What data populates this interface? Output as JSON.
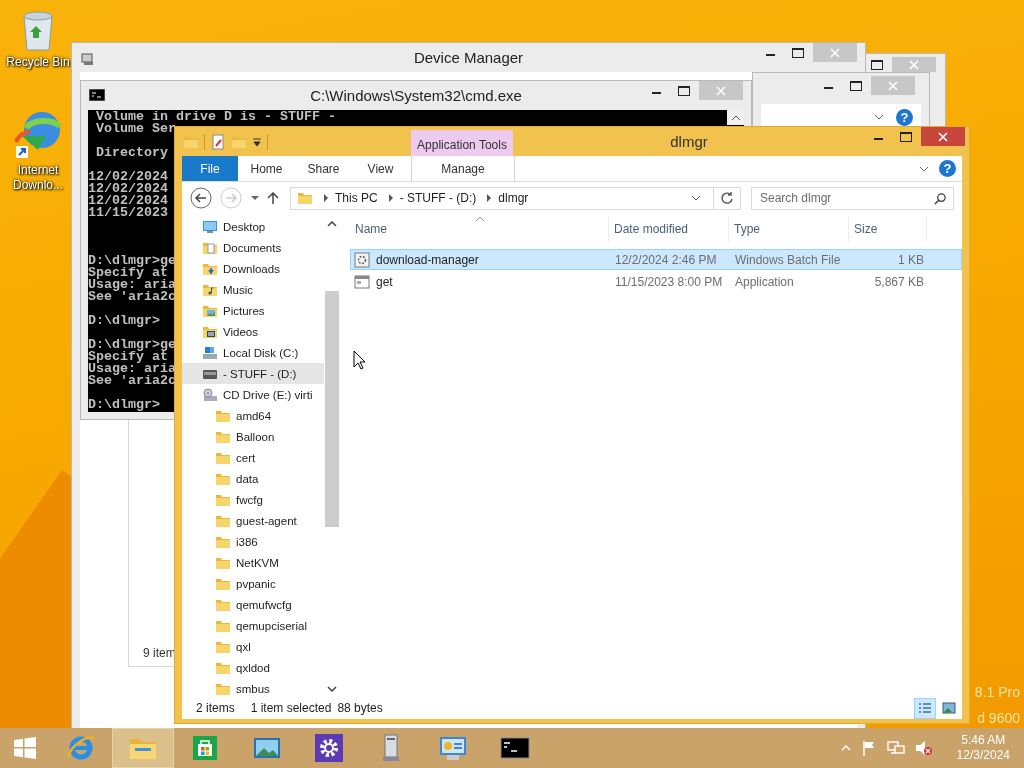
{
  "desktop": {
    "icons": [
      {
        "label": "Recycle Bin",
        "kind": "recycle-bin"
      },
      {
        "label": "Internet Downlo...",
        "kind": "download-app"
      }
    ],
    "edition_lines": [
      "8.1 Pro",
      "d 9600"
    ]
  },
  "device_manager": {
    "title": "Device Manager",
    "status": "9 item"
  },
  "help_window": {
    "help": "?"
  },
  "cmd": {
    "title": "C:\\Windows\\System32\\cmd.exe",
    "blocks": [
      {
        "kind": "output",
        "lines": [
          "Volume in drive D is - STUFF -",
          "Volume Ser"
        ]
      },
      {
        "kind": "output",
        "lines": [
          "Directory"
        ]
      },
      {
        "kind": "listing",
        "lines": [
          "12/02/2024",
          "12/02/2024",
          "12/02/2024",
          "11/15/2023"
        ]
      },
      {
        "kind": "output",
        "lines": [
          "D:\\dlmgr>ge",
          "Specify at",
          "Usage: aria",
          "See 'aria2c"
        ]
      },
      {
        "kind": "output",
        "lines": [
          "D:\\dlmgr>"
        ]
      },
      {
        "kind": "output",
        "lines": [
          "D:\\dlmgr>ge",
          "Specify at",
          "Usage: aria",
          "See 'aria2c"
        ]
      },
      {
        "kind": "output",
        "lines": [
          "D:\\dlmgr>"
        ]
      }
    ]
  },
  "explorer": {
    "title": "dlmgr",
    "context_group": "Application Tools",
    "help": "?",
    "tabs": [
      {
        "label": "File",
        "kind": "file"
      },
      {
        "label": "Home",
        "kind": "tab"
      },
      {
        "label": "Share",
        "kind": "tab"
      },
      {
        "label": "View",
        "kind": "tab"
      },
      {
        "label": "Manage",
        "kind": "context"
      }
    ],
    "address": [
      "This PC",
      "- STUFF - (D:)",
      "dlmgr"
    ],
    "search": {
      "placeholder": "Search dlmgr"
    },
    "tree": [
      {
        "label": "Desktop",
        "kind": "desktop",
        "selected": false
      },
      {
        "label": "Documents",
        "kind": "documents",
        "selected": false
      },
      {
        "label": "Downloads",
        "kind": "downloads",
        "selected": false
      },
      {
        "label": "Music",
        "kind": "music",
        "selected": false
      },
      {
        "label": "Pictures",
        "kind": "pictures",
        "selected": false
      },
      {
        "label": "Videos",
        "kind": "videos",
        "selected": false
      },
      {
        "label": "Local Disk (C:)",
        "kind": "disk",
        "selected": false
      },
      {
        "label": "- STUFF - (D:)",
        "kind": "drive",
        "selected": true
      },
      {
        "label": "CD Drive (E:) virti",
        "kind": "cd",
        "selected": false,
        "children": [
          {
            "label": "amd64",
            "kind": "folder",
            "selected": false
          },
          {
            "label": "Balloon",
            "kind": "folder",
            "selected": false
          },
          {
            "label": "cert",
            "kind": "folder",
            "selected": false
          },
          {
            "label": "data",
            "kind": "folder",
            "selected": false
          },
          {
            "label": "fwcfg",
            "kind": "folder",
            "selected": false
          },
          {
            "label": "guest-agent",
            "kind": "folder",
            "selected": false
          },
          {
            "label": "i386",
            "kind": "folder",
            "selected": false
          },
          {
            "label": "NetKVM",
            "kind": "folder",
            "selected": false
          },
          {
            "label": "pvpanic",
            "kind": "folder",
            "selected": false
          },
          {
            "label": "qemufwcfg",
            "kind": "folder",
            "selected": false
          },
          {
            "label": "qemupciserial",
            "kind": "folder",
            "selected": false
          },
          {
            "label": "qxl",
            "kind": "folder",
            "selected": false
          },
          {
            "label": "qxldod",
            "kind": "folder",
            "selected": false
          },
          {
            "label": "smbus",
            "kind": "folder",
            "selected": false
          }
        ]
      }
    ],
    "files": {
      "columns": [
        "Name",
        "Date modified",
        "Type",
        "Size"
      ],
      "rows": [
        {
          "name": "download-manager",
          "kind": "batch",
          "date": "12/2/2024 2:46 PM",
          "type": "Windows Batch File",
          "size": "1 KB",
          "selected": true
        },
        {
          "name": "get",
          "kind": "application",
          "date": "11/15/2023 8:00 PM",
          "type": "Application",
          "size": "5,867 KB",
          "selected": false
        }
      ]
    },
    "status": [
      "2 items",
      "1 item selected",
      "88 bytes"
    ],
    "views": [
      {
        "kind": "details",
        "selected": true
      },
      {
        "kind": "large-icons",
        "selected": false
      }
    ]
  },
  "taskbar": {
    "apps": [
      {
        "kind": "browser",
        "selected": false
      },
      {
        "kind": "file-explorer",
        "selected": true
      },
      {
        "kind": "store",
        "selected": false
      },
      {
        "kind": "photos",
        "selected": false
      },
      {
        "kind": "settings",
        "selected": false
      },
      {
        "kind": "server",
        "selected": false
      },
      {
        "kind": "control-panel",
        "selected": false
      },
      {
        "kind": "console",
        "selected": false
      }
    ],
    "time": "5:46 AM",
    "date": "12/3/2024"
  }
}
